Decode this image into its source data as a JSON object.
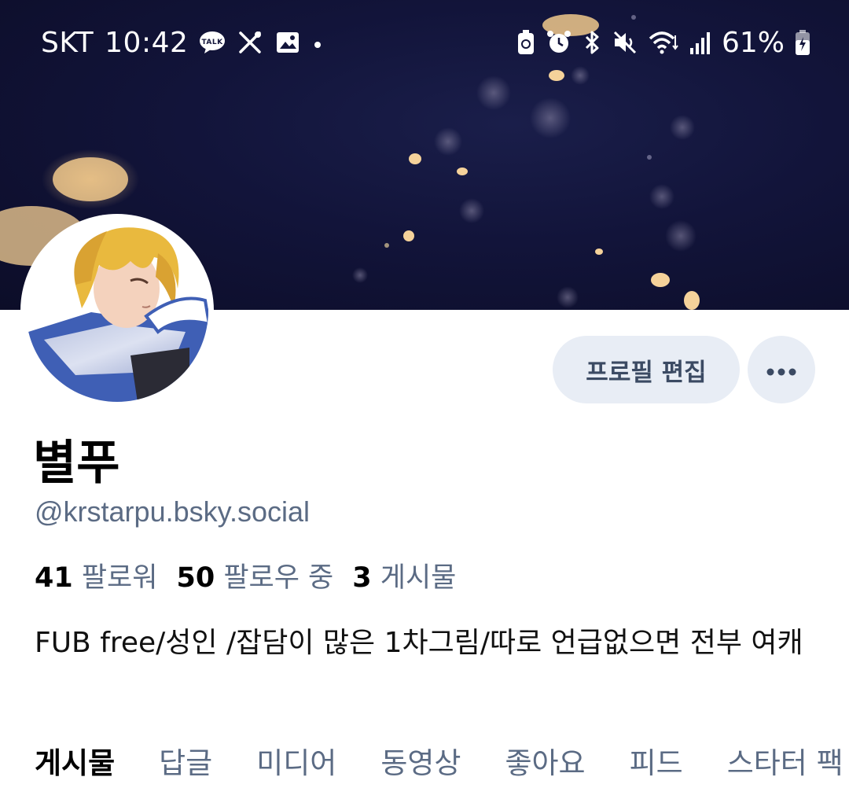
{
  "status_bar": {
    "carrier": "SKT",
    "time": "10:42",
    "talk_icon_label": "TALK",
    "battery_percent": "61%",
    "left_icons": [
      "talk-icon",
      "tools-icon",
      "gallery-icon",
      "dot-icon"
    ],
    "right_icons": [
      "battery-saver-icon",
      "alarm-icon",
      "bluetooth-icon",
      "mute-icon",
      "wifi-icon",
      "signal-icon",
      "battery-icon"
    ]
  },
  "profile": {
    "display_name": "별푸",
    "handle": "@krstarpu.bsky.social",
    "edit_button_label": "프로필 편집",
    "more_button_icon": "more-horizontal-icon",
    "bio": "FUB free/성인 /잡담이 많은 1차그림/따로 언급없으면 전부 여캐"
  },
  "stats": {
    "followers": {
      "count": "41",
      "label": "팔로워"
    },
    "following": {
      "count": "50",
      "label": "팔로우 중"
    },
    "posts": {
      "count": "3",
      "label": "게시물"
    }
  },
  "tabs": [
    {
      "label": "게시물",
      "active": true
    },
    {
      "label": "답글",
      "active": false
    },
    {
      "label": "미디어",
      "active": false
    },
    {
      "label": "동영상",
      "active": false
    },
    {
      "label": "좋아요",
      "active": false
    },
    {
      "label": "피드",
      "active": false
    },
    {
      "label": "스타터 팩",
      "active": false
    }
  ],
  "colors": {
    "banner_bg": "#12143a",
    "button_bg": "#e8edf5",
    "secondary_text": "#5b6b84",
    "primary_text": "#000000"
  }
}
